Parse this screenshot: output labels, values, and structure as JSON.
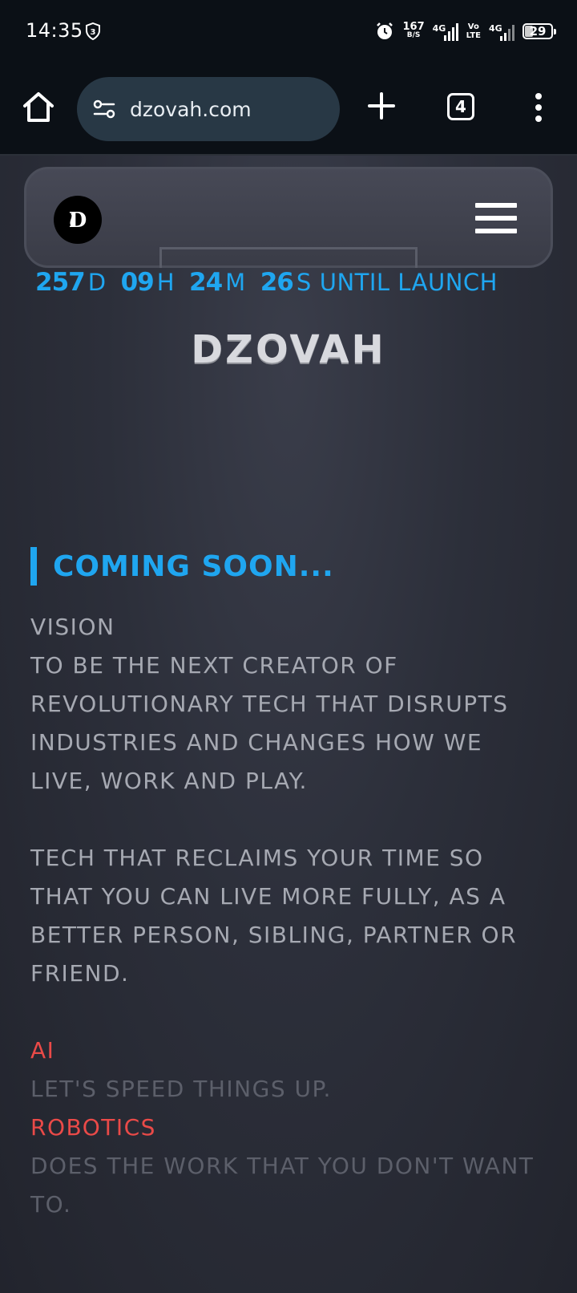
{
  "status_bar": {
    "time": "14:35",
    "notification_badge": "3",
    "net_speed_value": "167",
    "net_speed_unit": "B/S",
    "sim1_label": "4G",
    "volte_line1": "Vo",
    "volte_line2": "LTE",
    "sim2_label": "4G",
    "battery_level": "29",
    "icons": [
      "shield-icon",
      "alarm-icon",
      "signal-icon",
      "battery-icon"
    ]
  },
  "browser": {
    "url": "dzovah.com",
    "tab_count": "4",
    "icons": [
      "home-icon",
      "site-settings-icon",
      "plus-icon",
      "more-vert-icon"
    ]
  },
  "site": {
    "logo_text": "D",
    "countdown": {
      "days": "257",
      "days_unit": "D",
      "hours": "09",
      "hours_unit": "H",
      "minutes": "24",
      "minutes_unit": "M",
      "seconds": "26",
      "seconds_unit": "S",
      "suffix": "UNTIL LAUNCH"
    },
    "title": "DZOVAH",
    "coming_soon": "COMING SOON...",
    "vision_heading": "VISION",
    "vision_text": "TO BE THE NEXT CREATOR OF REVOLUTIONARY TECH THAT DISRUPTS INDUSTRIES AND CHANGES HOW WE LIVE, WORK AND PLAY.",
    "mission_text": "TECH THAT RECLAIMS YOUR TIME SO THAT YOU CAN LIVE MORE FULLY, AS A BETTER PERSON, SIBLING, PARTNER OR FRIEND.",
    "pillars": [
      {
        "name": "AI",
        "tagline": "LET'S SPEED THINGS UP."
      },
      {
        "name": "ROBOTICS",
        "tagline": "DOES THE WORK THAT YOU DON'T WANT TO."
      }
    ],
    "colors": {
      "accent": "#1fa6f0",
      "highlight": "#ea4a48",
      "text": "#a6a9b2",
      "dim": "#5c5f6a"
    }
  }
}
